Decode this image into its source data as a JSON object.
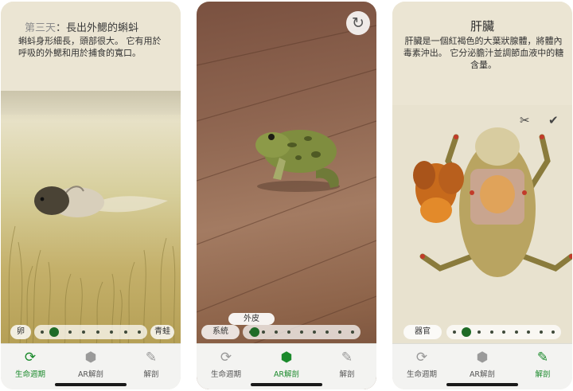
{
  "phone1": {
    "title_day": "第三天",
    "title_text": "：長出外鰓的蝌蚪",
    "description": "蝌蚪身形細長，頭部很大。 它有用於呼吸的外鰓和用於捕食的寬口。",
    "slider": {
      "start_label": "卵",
      "end_label": "青蛙",
      "position": 0.12,
      "dot_count": 8
    }
  },
  "phone2": {
    "rotate_icon": "rotate-icon",
    "layer_label": "外皮",
    "system_label": "系統",
    "slider": {
      "position": 0.04,
      "dot_count": 9
    }
  },
  "phone3": {
    "title": "肝臟",
    "description": "肝臟是一個紅褐色的大葉狀腺體，將體內毒素沖出。 它分泌膽汁並調節血液中的糖含量。",
    "tools": {
      "scissors_icon": "scissors-icon",
      "check_icon": "cut-check-icon"
    },
    "organ_label": "器官",
    "slider": {
      "position": 0.12,
      "dot_count": 9
    }
  },
  "tabs": [
    {
      "label": "生命週期",
      "icon": "lifecycle-icon"
    },
    {
      "label": "AR解剖",
      "icon": "ar-cube-icon"
    },
    {
      "label": "解剖",
      "icon": "pencil-icon"
    }
  ],
  "active_tabs": {
    "phone1": 0,
    "phone2": 1,
    "phone3": 2
  },
  "colors": {
    "accent": "#1b8a2c",
    "knob": "#1f6b27",
    "liver": "#c76a1c"
  }
}
